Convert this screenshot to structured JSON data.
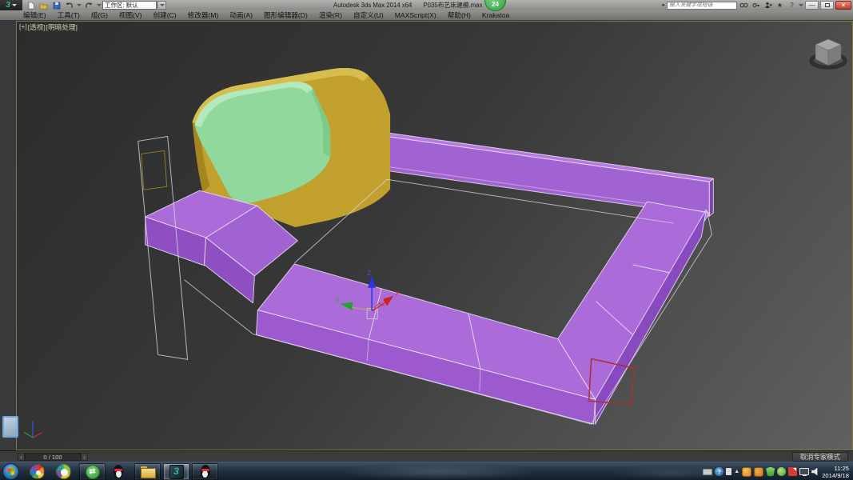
{
  "title_bar": {
    "app_title": "Autodesk 3ds Max  2014 x64",
    "file_name": "P035布艺床建模.max",
    "workspace_label": "工作区: 默认",
    "search_placeholder": "输入关键字或短语",
    "badge_count": "24"
  },
  "menu_bar": {
    "items": [
      "编辑(E)",
      "工具(T)",
      "组(G)",
      "视图(V)",
      "创建(C)",
      "修改器(M)",
      "动画(A)",
      "图形编辑器(D)",
      "渲染(R)",
      "自定义(U)",
      "MAXScript(X)",
      "帮助(H)",
      "Krakatoa"
    ]
  },
  "viewport": {
    "label_general": "[+]",
    "label_view": "[透视]",
    "label_shading": "[明暗处理]",
    "axis": {
      "x": "X",
      "y": "Y",
      "z": "Z"
    }
  },
  "timeline": {
    "prev": "‹",
    "next": "›",
    "frame_display": "0 / 100"
  },
  "status_bar": {
    "expert_mode_button": "取消专家模式"
  },
  "taskbar": {
    "clock_time": "11:25",
    "clock_date": "2014/9/18"
  },
  "icons": {
    "max_logo_glyph": "3",
    "expand_glyph": "▸",
    "help_glyph": "?",
    "star_glyph": "★",
    "min_glyph": "—",
    "close_glyph": "×",
    "updater_glyph": "⇄",
    "tray_help_glyph": "?",
    "tray_up_glyph": "▲",
    "search_side_glyph": "▸"
  },
  "colors": {
    "frame_purple_top": "#ab6cd9",
    "frame_purple_front": "#9c5ace",
    "headboard_yellow": "#c2a02e",
    "cushion_green": "#90d89b",
    "selection_red": "#a83030",
    "viewport_border_olive": "#7b7b4a",
    "badge_green": "#2f9e3a",
    "gizmo_x_red": "#d02020",
    "gizmo_y_green": "#1fa32c",
    "gizmo_z_blue": "#2b35e0"
  }
}
